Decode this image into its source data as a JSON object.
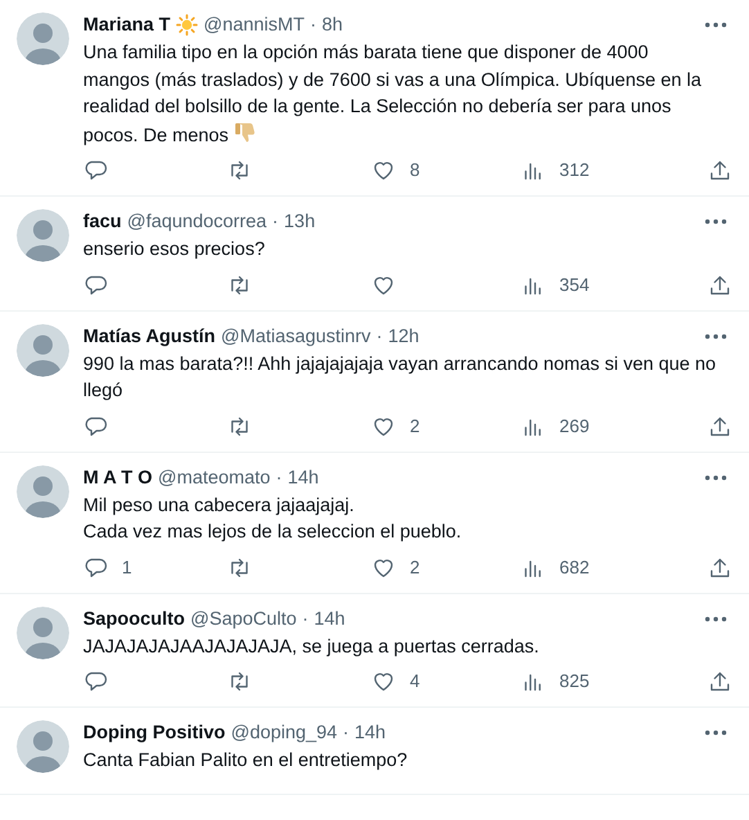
{
  "tweets": [
    {
      "name": "Mariana T",
      "name_emoji": true,
      "handle": "@nannisMT",
      "dot": "·",
      "time": "8h",
      "text": "Una familia tipo en la opción más barata tiene que disponer de 4000 mangos (más traslados) y de 7600 si vas a una Olímpica. Ubíquense en la realidad del bolsillo de la gente. La Selección no debería ser para unos pocos. De menos",
      "text_emoji": true,
      "actions": {
        "likes": "8",
        "views": "312"
      }
    },
    {
      "name": "facu",
      "handle": "@faqundocorrea",
      "dot": "·",
      "time": "13h",
      "text": "enserio esos precios?",
      "actions": {
        "views": "354"
      }
    },
    {
      "name": "Matías Agustín",
      "handle": "@Matiasagustinrv",
      "dot": "·",
      "time": "12h",
      "text": "990 la mas barata?!! Ahh jajajajajaja vayan arrancando nomas si ven que no llegó",
      "actions": {
        "likes": "2",
        "views": "269"
      }
    },
    {
      "name": "M A T O",
      "handle": "@mateomato",
      "dot": "·",
      "time": "14h",
      "text": "Mil peso una cabecera jajaajajaj.\nCada vez mas lejos de la seleccion el pueblo.",
      "actions": {
        "replies": "1",
        "likes": "2",
        "views": "682"
      }
    },
    {
      "name": "Sapooculto",
      "handle": "@SapoCulto",
      "dot": "·",
      "time": "14h",
      "text": "JAJAJAJAJAAJAJAJAJA, se juega a puertas cerradas.",
      "actions": {
        "likes": "4",
        "views": "825"
      }
    },
    {
      "name": "Doping Positivo",
      "handle": "@doping_94",
      "dot": "·",
      "time": "14h",
      "text": "Canta Fabian Palito en el entretiempo?"
    }
  ]
}
